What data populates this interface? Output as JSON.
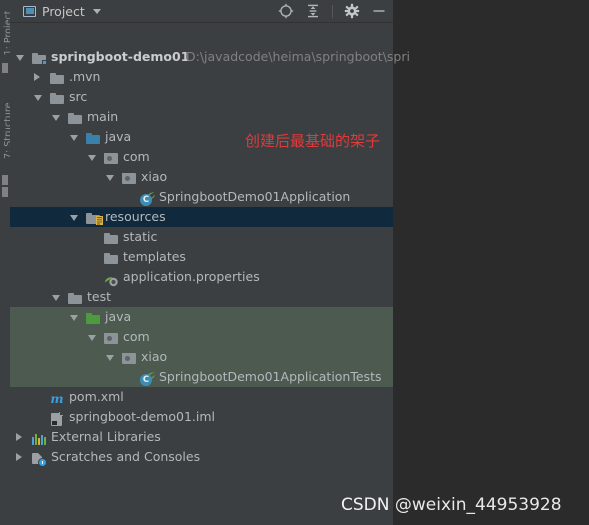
{
  "window": {
    "tool_strip": {
      "project_label": "1: Project",
      "structure_label": "7: Structure"
    },
    "header": {
      "title": "Project",
      "project_icon": "project-icon",
      "dropdown_icon": "chevron-down-icon",
      "actions": [
        {
          "name": "select-opened-file-icon",
          "label": ""
        },
        {
          "name": "collapse-all-icon",
          "label": ""
        },
        {
          "name": "settings-gear-icon",
          "label": ""
        },
        {
          "name": "hide-panel-icon",
          "label": ""
        }
      ]
    }
  },
  "tree": {
    "rows": [
      {
        "label": "springboot-demo01",
        "path": "D:\\javadcode\\heima\\springboot\\spri",
        "depth": 0,
        "arrow": "open",
        "icon": "module-folder-icon",
        "bold": true,
        "highlight": "none"
      },
      {
        "label": ".mvn",
        "path": "",
        "depth": 1,
        "arrow": "closed",
        "icon": "folder-icon",
        "bold": false,
        "highlight": "none"
      },
      {
        "label": "src",
        "path": "",
        "depth": 1,
        "arrow": "open",
        "icon": "folder-icon",
        "bold": false,
        "highlight": "none"
      },
      {
        "label": "main",
        "path": "",
        "depth": 2,
        "arrow": "open",
        "icon": "folder-icon",
        "bold": false,
        "highlight": "none"
      },
      {
        "label": "java",
        "path": "",
        "depth": 3,
        "arrow": "open",
        "icon": "sources-folder-icon",
        "bold": false,
        "highlight": "none"
      },
      {
        "label": "com",
        "path": "",
        "depth": 4,
        "arrow": "open",
        "icon": "package-icon",
        "bold": false,
        "highlight": "none"
      },
      {
        "label": "xiao",
        "path": "",
        "depth": 5,
        "arrow": "open",
        "icon": "package-icon",
        "bold": false,
        "highlight": "none"
      },
      {
        "label": "SpringbootDemo01Application",
        "path": "",
        "depth": 6,
        "arrow": "none",
        "icon": "spring-class-icon",
        "bold": false,
        "highlight": "none"
      },
      {
        "label": "resources",
        "path": "",
        "depth": 3,
        "arrow": "open",
        "icon": "resources-folder-icon",
        "bold": false,
        "highlight": "blue"
      },
      {
        "label": "static",
        "path": "",
        "depth": 4,
        "arrow": "none",
        "icon": "folder-icon",
        "bold": false,
        "highlight": "none"
      },
      {
        "label": "templates",
        "path": "",
        "depth": 4,
        "arrow": "none",
        "icon": "folder-icon",
        "bold": false,
        "highlight": "none"
      },
      {
        "label": "application.properties",
        "path": "",
        "depth": 4,
        "arrow": "none",
        "icon": "properties-file-icon",
        "bold": false,
        "highlight": "none"
      },
      {
        "label": "test",
        "path": "",
        "depth": 2,
        "arrow": "open",
        "icon": "folder-icon",
        "bold": false,
        "highlight": "none"
      },
      {
        "label": "java",
        "path": "",
        "depth": 3,
        "arrow": "open",
        "icon": "test-sources-folder-icon",
        "bold": false,
        "highlight": "green"
      },
      {
        "label": "com",
        "path": "",
        "depth": 4,
        "arrow": "open",
        "icon": "package-icon",
        "bold": false,
        "highlight": "green"
      },
      {
        "label": "xiao",
        "path": "",
        "depth": 5,
        "arrow": "open",
        "icon": "package-icon",
        "bold": false,
        "highlight": "green"
      },
      {
        "label": "SpringbootDemo01ApplicationTests",
        "path": "",
        "depth": 6,
        "arrow": "none",
        "icon": "spring-test-class-icon",
        "bold": false,
        "highlight": "green"
      },
      {
        "label": "pom.xml",
        "path": "",
        "depth": 1,
        "arrow": "none",
        "icon": "maven-icon",
        "bold": false,
        "highlight": "none"
      },
      {
        "label": "springboot-demo01.iml",
        "path": "",
        "depth": 1,
        "arrow": "none",
        "icon": "iml-file-icon",
        "bold": false,
        "highlight": "none"
      },
      {
        "label": "External Libraries",
        "path": "",
        "depth": 0,
        "arrow": "closed",
        "icon": "libraries-icon",
        "bold": false,
        "highlight": "none"
      },
      {
        "label": "Scratches and Consoles",
        "path": "",
        "depth": 0,
        "arrow": "closed",
        "icon": "scratches-icon",
        "bold": false,
        "highlight": "none"
      }
    ]
  },
  "annotation": {
    "text": "创建后最基础的架子",
    "color": "#e03a3a"
  },
  "watermark": {
    "prefix": "CSDN",
    "text": " @weixin_44953928"
  },
  "colors": {
    "panel_bg": "#3c3f41",
    "editor_bg": "#2b2b2b",
    "selection_blue": "#10293d",
    "selection_green": "#4d5a4f",
    "text": "#b3b8bc",
    "path_text": "#808080"
  }
}
